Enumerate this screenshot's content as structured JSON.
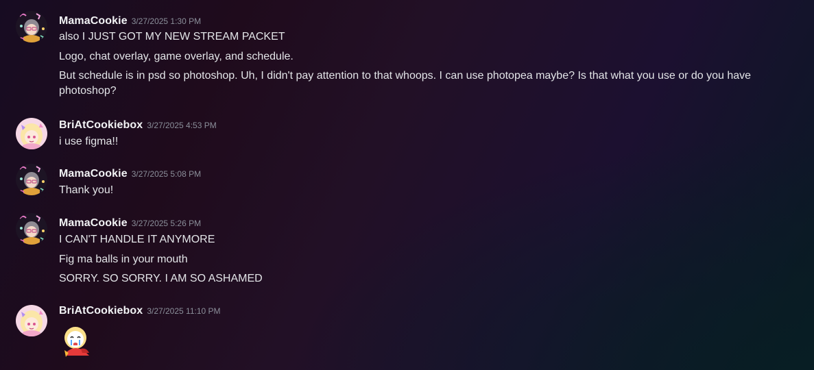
{
  "messages": [
    {
      "username": "MamaCookie",
      "timestamp": "3/27/2025 1:30 PM",
      "avatar_icon": "mamacookie-avatar-icon",
      "lines": [
        "also  I JUST GOT MY NEW STREAM PACKET",
        "Logo, chat overlay, game overlay, and schedule.",
        "But schedule is in psd so photoshop. Uh, I didn't pay attention to that whoops. I can use photopea maybe? Is that what you use or do you have photoshop?"
      ]
    },
    {
      "username": "BriAtCookiebox",
      "timestamp": "3/27/2025 4:53 PM",
      "avatar_icon": "briatcookiebox-avatar-icon",
      "lines": [
        "i use figma!!"
      ]
    },
    {
      "username": "MamaCookie",
      "timestamp": "3/27/2025 5:08 PM",
      "avatar_icon": "mamacookie-avatar-icon",
      "lines": [
        "Thank you!"
      ]
    },
    {
      "username": "MamaCookie",
      "timestamp": "3/27/2025 5:26 PM",
      "avatar_icon": "mamacookie-avatar-icon",
      "lines": [
        "I CAN'T HANDLE IT ANYMORE",
        "Fig ma balls in your mouth",
        "SORRY. SO SORRY. I AM SO ASHAMED"
      ]
    },
    {
      "username": "BriAtCookiebox",
      "timestamp": "3/27/2025 11:10 PM",
      "avatar_icon": "briatcookiebox-avatar-icon",
      "emoji": "crying-character-emoji-icon"
    }
  ]
}
